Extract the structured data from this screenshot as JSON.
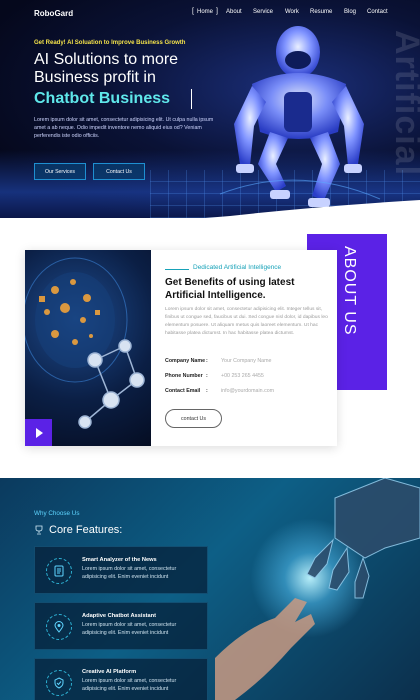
{
  "nav": {
    "brand": "RoboGard",
    "items": [
      "Home",
      "About",
      "Service",
      "Work",
      "Resume",
      "Blog",
      "Contact"
    ]
  },
  "hero": {
    "tagline": "Get Ready! AI Soluation to Improve Business Growth",
    "line1": "AI Solutions to more",
    "line2": "Business profit in",
    "line3": "Chatbot Business",
    "description": "Lorem ipsum dolor sit amet, consectetur adipisicing elit. Ut culpa nulla ipsum amet a ab neque. Odio impedit inventore nemo aliquid eius od? Veniam perferendis iste odio officiis.",
    "buttons": [
      "Our Services",
      "Contact Us"
    ],
    "vertical_word": "Artificial"
  },
  "about": {
    "side_label": "ABOUT US",
    "subtitle": "Dedicated Artificial Intelligence",
    "title_line1": "Get Benefits of using latest",
    "title_line2": "Artificial Intelligence.",
    "paragraph": "Lorem ipsum dolor sit amet, consectetur adipisicing elit. Integer tellus sit, finibus ut congue sed, faucibus ut dui. Sed congue nisl dolor, id dapibus leo elementum posuere. Ut aliquam metus quis laoreet elementum. Ut hac habitasse platea dictumst. In hac habitasse platea dictumst.",
    "info": [
      {
        "label": "Company Name",
        "value": "Your Company Name"
      },
      {
        "label": "Phone Number",
        "value": "+00 253 265 4455"
      },
      {
        "label": "Contact Email",
        "value": "info@yourdomain.com"
      }
    ],
    "button": "contact Us"
  },
  "features": {
    "eyebrow": "Why Choose Us",
    "heading": "Core Features:",
    "items": [
      {
        "title": "Smart Analyzer of the News",
        "desc": "Lorem ipsum dolor sit amet, consectetur adipisicing elit. Enim eveniet incidunt",
        "icon": "document-icon"
      },
      {
        "title": "Adaptive Chatbot Assistant",
        "desc": "Lorem ipsum dolor sit amet, consectetur adipisicing elit. Enim eveniet incidunt",
        "icon": "location-pin-icon"
      },
      {
        "title": "Creative AI Platform",
        "desc": "Lorem ipsum dolor sit amet, consectetur adipisicing elit. Enim eveniet incidunt",
        "icon": "shield-check-icon"
      }
    ]
  },
  "colors": {
    "accent_purple": "#5b22e6",
    "accent_cyan": "#5fe7ea",
    "tagline_yellow": "#f4e24a",
    "teal": "#17a2b8"
  }
}
